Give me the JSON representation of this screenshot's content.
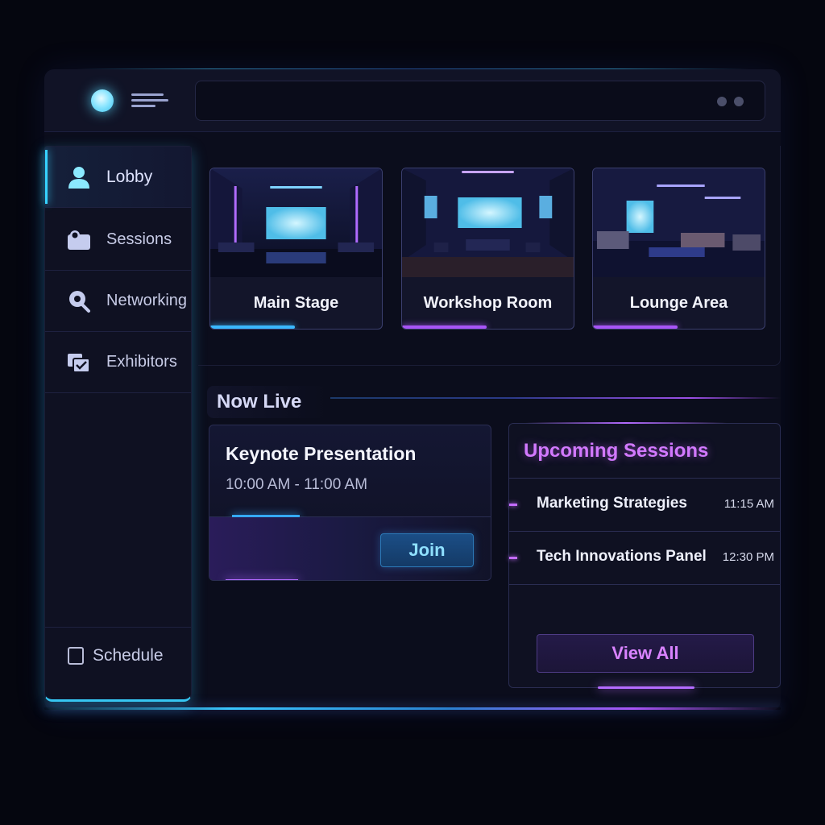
{
  "sidebar": {
    "items": [
      {
        "label": "Lobby",
        "icon": "user-icon",
        "active": true
      },
      {
        "label": "Sessions",
        "icon": "sessions-icon",
        "active": false
      },
      {
        "label": "Networking",
        "icon": "networking-icon",
        "active": false
      },
      {
        "label": "Exhibitors",
        "icon": "exhibitors-icon",
        "active": false
      }
    ],
    "schedule_label": "Schedule"
  },
  "rooms": [
    {
      "name": "Main Stage",
      "accent": "#3ab8ff"
    },
    {
      "name": "Workshop Room",
      "accent": "#a855f7"
    },
    {
      "name": "Lounge Area",
      "accent": "#a855f7"
    }
  ],
  "now_live": {
    "heading": "Now Live",
    "title": "Keynote Presentation",
    "time": "10:00 AM - 11:00 AM",
    "join_label": "Join"
  },
  "upcoming": {
    "heading": "Upcoming Sessions",
    "sessions": [
      {
        "name": "Marketing Strategies",
        "time": "11:15 AM"
      },
      {
        "name": "Tech Innovations Panel",
        "time": "12:30 PM"
      }
    ],
    "view_all_label": "View All"
  },
  "colors": {
    "background": "#05060f",
    "panel": "#0f1122",
    "cyan_accent": "#36d2ff",
    "purple_accent": "#c46bff"
  }
}
